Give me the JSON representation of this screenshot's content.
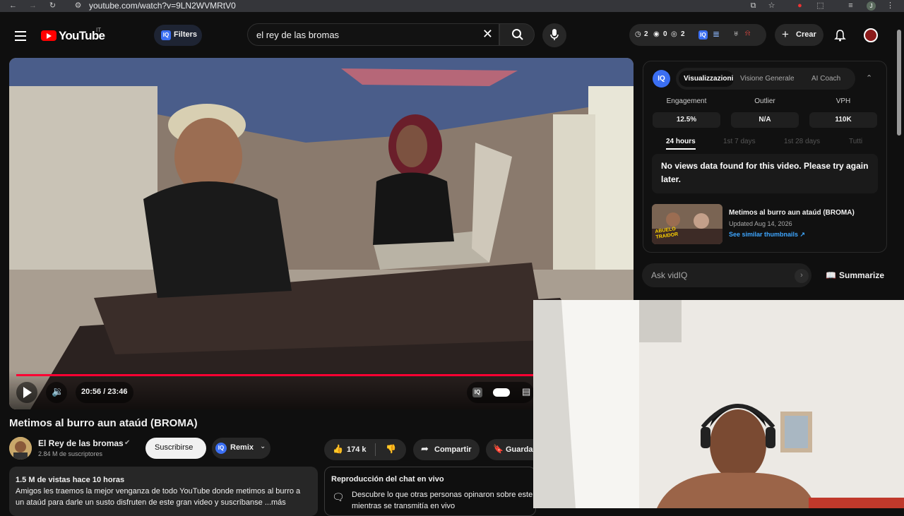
{
  "browser": {
    "url": "youtube.com/watch?v=9LN2WVMRtV0",
    "profile_letter": "J"
  },
  "header": {
    "logo": "YouTube",
    "country": "IT",
    "filters_label": "Filters",
    "search_value": "el rey de las bromas",
    "stats": {
      "clock": "2",
      "views": "0",
      "eye": "2"
    },
    "create_label": "Crear"
  },
  "player": {
    "time": "20:56 / 23:46",
    "progress": 0.8811
  },
  "video": {
    "title": "Metimos al burro aun ataúd (BROMA)",
    "channel": "El Rey de las bromas",
    "subscribers": "2.84 M de suscriptores",
    "subscribe_label": "Suscribirse",
    "remix_label": "Remix",
    "likes": "174 k",
    "share_label": "Compartir",
    "save_label": "Guardar",
    "description_meta": "1.5 M de vistas  hace 10 horas",
    "description_line1": "Amigos les traemos la mejor venganza de todo YouTube donde metimos al burro a",
    "description_line2": "un ataúd para darle un susto disfruten de este gran video y suscríbanse ...más",
    "chat_title": "Reproducción del chat en vivo",
    "chat_line1": "Descubre lo que otras personas opinaron sobre este",
    "chat_line2": "mientras se transmitía en vivo"
  },
  "vidiq": {
    "tabs": [
      "Visualizzazioni",
      "Visione Generale",
      "AI Coach"
    ],
    "metrics": [
      {
        "label": "Engagement",
        "value": "12.5%"
      },
      {
        "label": "Outlier",
        "value": "N/A"
      },
      {
        "label": "VPH",
        "value": "110K"
      }
    ],
    "ranges": [
      "24 hours",
      "1st 7 days",
      "1st 28 days",
      "Tutti"
    ],
    "no_views": "No views data found for this video. Please try again later.",
    "thumb_title": "Metimos al burro aun ataúd (BROMA)",
    "thumb_updated": "Updated Aug 14, 2026",
    "thumb_link": "See similar thumbnails ↗",
    "thumb_badge": "ABUELO TRAIDOR",
    "ask_placeholder": "Ask vidIQ",
    "summarize_label": "Summarize"
  },
  "colors": {
    "accent_red": "#ff0033",
    "vidiq_blue": "#3b6ff3",
    "link_blue": "#3ea6ff"
  }
}
